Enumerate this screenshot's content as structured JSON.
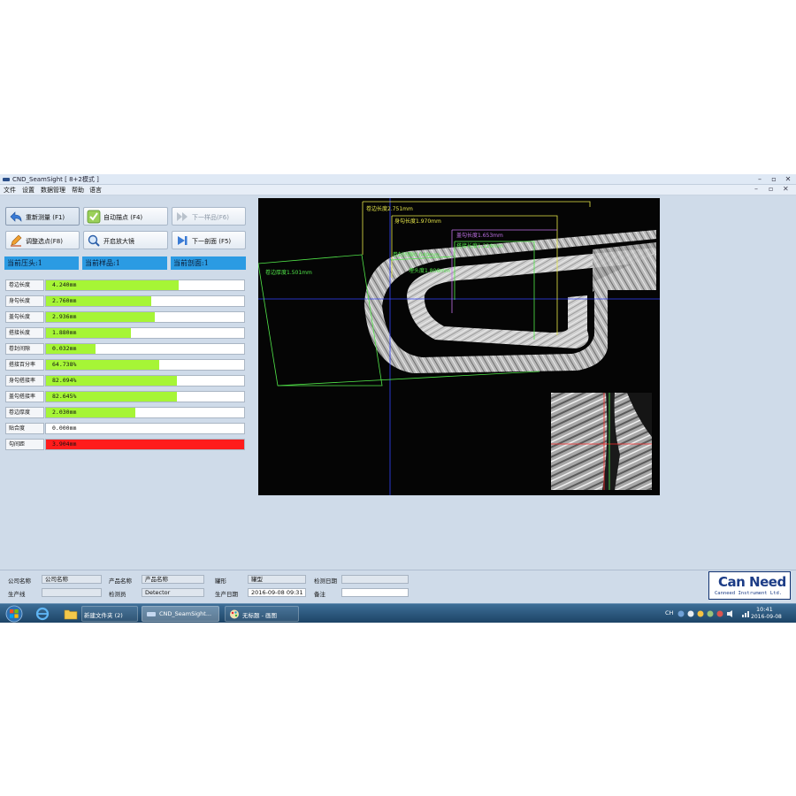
{
  "window": {
    "title": "CND_SeamSight [ 8+2模式 ]",
    "controls": [
      "–",
      "▫",
      "✕"
    ]
  },
  "menu": {
    "items": [
      "文件",
      "设置",
      "数据管理",
      "帮助",
      "语言"
    ],
    "mdi_controls": [
      "–",
      "▫",
      "✕"
    ]
  },
  "toolbar": {
    "remeasure": "重新测量 (F1)",
    "auto_point": "自动描点 (F4)",
    "next_sample": "下一样品(F6)",
    "adjust_points": "调整选点(F8)",
    "magnifier": "开启放大镜",
    "next_section": "下一剖面 (F5)"
  },
  "status": {
    "head": "当前压头:1",
    "sample": "当前样品:1",
    "section": "当前剖面:1"
  },
  "measurements": [
    {
      "label": "卷边长度",
      "value": "4.240mm",
      "fill": 0.67,
      "color": "#a6f536"
    },
    {
      "label": "身勾长度",
      "value": "2.760mm",
      "fill": 0.53,
      "color": "#a6f536"
    },
    {
      "label": "盖勾长度",
      "value": "2.936mm",
      "fill": 0.55,
      "color": "#a6f536"
    },
    {
      "label": "搭接长度",
      "value": "1.880mm",
      "fill": 0.43,
      "color": "#a6f536"
    },
    {
      "label": "卷封间隙",
      "value": "0.032mm",
      "fill": 0.25,
      "color": "#a6f536"
    },
    {
      "label": "搭接百分率",
      "value": "64.738%",
      "fill": 0.57,
      "color": "#a6f536"
    },
    {
      "label": "身勾搭接率",
      "value": "82.094%",
      "fill": 0.66,
      "color": "#a6f536"
    },
    {
      "label": "盖勾搭接率",
      "value": "82.645%",
      "fill": 0.66,
      "color": "#a6f536"
    },
    {
      "label": "卷边厚度",
      "value": "2.030mm",
      "fill": 0.45,
      "color": "#a6f536"
    },
    {
      "label": "贴合度",
      "value": "0.000mm",
      "fill": 0.0,
      "color": "#a6f536"
    },
    {
      "label": "勾间距",
      "value": "3.904mm",
      "fill": 1.0,
      "color": "#ff1c1c"
    }
  ],
  "viewer": {
    "annotations": [
      {
        "text": "卷边长度2.751mm",
        "color": "#e8e84a"
      },
      {
        "text": "身勾长度1.970mm",
        "color": "#e8e84a"
      },
      {
        "text": "盖勾长度1.653mm",
        "color": "#c071e8"
      },
      {
        "text": "搭接长度1.226mm",
        "color": "#52e84a"
      },
      {
        "text": "卷封间隙0.049mm",
        "color": "#52e84a"
      },
      {
        "text": "卷边厚度1.501mm",
        "color": "#52e84a"
      },
      {
        "text": "埋头度1.806mm",
        "color": "#52e84a"
      }
    ]
  },
  "info": {
    "company_label": "公司名称",
    "company_value": "公司名称",
    "product_label": "产品名称",
    "product_value": "产品名称",
    "type_label": "罐形",
    "type_value": "罐型",
    "inspect_date_label": "检测日期",
    "inspect_date_value": "",
    "line_label": "生产线",
    "line_value": "",
    "inspector_label": "检测员",
    "inspector_value": "Detector",
    "prod_date_label": "生产日期",
    "prod_date_value": "2016-09-08 09:31",
    "remark_label": "备注",
    "remark_value": ""
  },
  "logo": {
    "line1_a": "Can",
    "line1_b": "Need",
    "line2": "Canneed Instrument Ltd."
  },
  "taskbar": {
    "items": [
      "新建文件夹 (2)",
      "CND_SeamSight...",
      "无标题 - 画图"
    ],
    "lang": "CH",
    "time": "10:41",
    "date": "2016-09-08"
  }
}
